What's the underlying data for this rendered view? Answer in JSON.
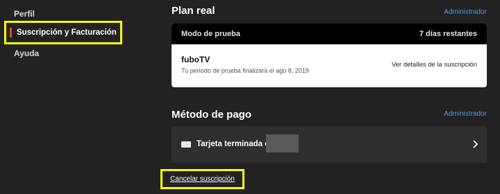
{
  "sidebar": {
    "items": [
      {
        "label": "Perfil"
      },
      {
        "label": "Suscripción y Facturación",
        "active": true
      },
      {
        "label": "Ayuda"
      }
    ]
  },
  "plan": {
    "title": "Plan real",
    "admin_label": "Administrador",
    "header_left": "Modo de prueba",
    "header_right": "7 días restantes",
    "name": "fuboTV",
    "subtitle": "Tu periodo de prueba finalizará el ago 8, 2019",
    "details_link": "Ver detalles de la suscripción"
  },
  "payment": {
    "title": "Método de pago",
    "admin_label": "Administrador",
    "card_label": "Tarjeta terminada en",
    "card_icon": "visa-card-icon"
  },
  "cancel": {
    "label": "Cancelar suscripción"
  },
  "colors": {
    "background": "#222222",
    "accent": "#fa4616",
    "link": "#3ba0ff",
    "highlight": "#ffff00"
  }
}
